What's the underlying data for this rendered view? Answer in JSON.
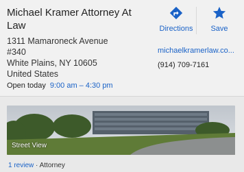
{
  "place": {
    "name": "Michael Kramer Attorney At Law",
    "address_lines": [
      "1311 Mamaroneck Avenue",
      "#340",
      "White Plains, NY 10605",
      "United States"
    ],
    "hours_label": "Open today",
    "hours_value": "9:00 am – 4:30 pm",
    "website": "michaelkramerlaw.co...",
    "phone": "(914) 709-7161"
  },
  "actions": {
    "directions_label": "Directions",
    "save_label": "Save"
  },
  "street_view": {
    "label": "Street View"
  },
  "footer": {
    "review_link": "1 review",
    "separator": " · ",
    "category": "Attorney"
  },
  "colors": {
    "link": "#1a62c7",
    "card_bg": "#f1f1f1"
  }
}
